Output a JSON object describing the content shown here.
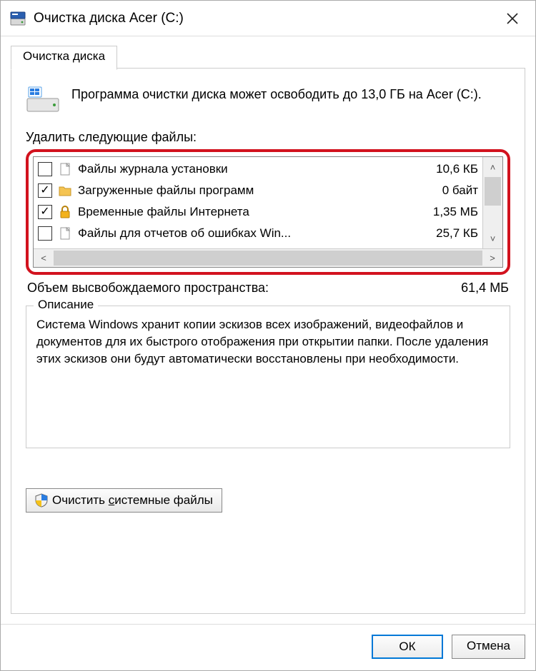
{
  "window": {
    "title": "Очистка диска Acer (C:)"
  },
  "tab": {
    "label": "Очистка диска"
  },
  "info": {
    "text": "Программа очистки диска может освободить до 13,0 ГБ на Acer (C:)."
  },
  "filelist": {
    "label": "Удалить следующие файлы:",
    "items": [
      {
        "checked": false,
        "icon": "file",
        "label": "Файлы журнала установки",
        "size": "10,6 КБ"
      },
      {
        "checked": true,
        "icon": "folder",
        "label": "Загруженные файлы программ",
        "size": "0 байт"
      },
      {
        "checked": true,
        "icon": "lock",
        "label": "Временные файлы Интернета",
        "size": "1,35 МБ"
      },
      {
        "checked": false,
        "icon": "file",
        "label": "Файлы для отчетов об ошибках Win...",
        "size": "25,7 КБ"
      }
    ]
  },
  "total": {
    "label": "Объем высвобождаемого пространства:",
    "value": "61,4 МБ"
  },
  "description": {
    "legend": "Описание",
    "text": "Система Windows хранит копии эскизов всех изображений, видеофайлов и документов для их быстрого отображения при открытии папки. После удаления этих эскизов они будут автоматически восстановлены при необходимости."
  },
  "buttons": {
    "cleanup_system_prefix": "Очистить ",
    "cleanup_system_underline": "с",
    "cleanup_system_suffix": "истемные файлы",
    "ok": "ОК",
    "cancel": "Отмена"
  }
}
